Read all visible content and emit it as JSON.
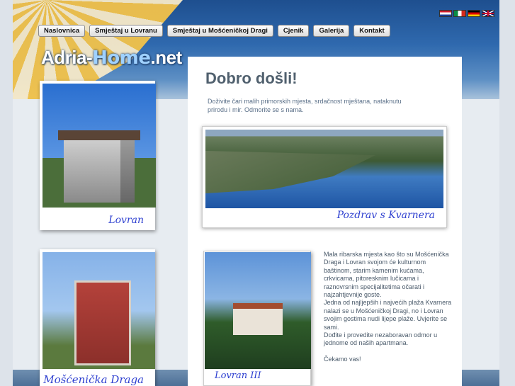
{
  "nav": {
    "items": [
      {
        "label": "Naslovnica"
      },
      {
        "label": "Smještaj u Lovranu"
      },
      {
        "label": "Smještaj u Mošćeničkoj Dragi"
      },
      {
        "label": "Cjenik"
      },
      {
        "label": "Galerija"
      },
      {
        "label": "Kontakt"
      }
    ]
  },
  "languages": [
    "flag-hr-icon",
    "flag-it-icon",
    "flag-de-icon",
    "flag-gb-icon"
  ],
  "logo": {
    "part1": "Adria-",
    "part2": "Home",
    "part3": ".net"
  },
  "side": {
    "card1_caption": "Lovran",
    "card2_caption": "Mošćenička Draga"
  },
  "main": {
    "title": "Dobro došli!",
    "intro": "Doživite čari malih primorskih mjesta, srdačnost mještana, nataknutu prirodu i mir. Odmorite se s nama.",
    "feature_caption": "Pozdrav s Kvarnera",
    "small_caption": "Lovran III",
    "body": [
      "Mala ribarska mjesta kao što su Mošćenička Draga i Lovran svojom će kulturnom baštinom, starim kamenim kućama, crkvicama, pitoresknim lučicama i raznovrsnim specijalitetima očarati i najzahtjevnije goste.",
      "Jedna od najljepših i najvećih plaža Kvarnera nalazi se u Mošćeničkoj Dragi, no i Lovran svojim gostima nudi lijepe plaže. Uvjerite se sami.",
      "Dođite i provedite nezaboravan odmor u jednome od naših apartmana.",
      "Čekamo vas!"
    ]
  },
  "colors": {
    "header_blue": "#2f69ae",
    "title_gray": "#50606e",
    "caption_blue": "#2d3fd0"
  }
}
